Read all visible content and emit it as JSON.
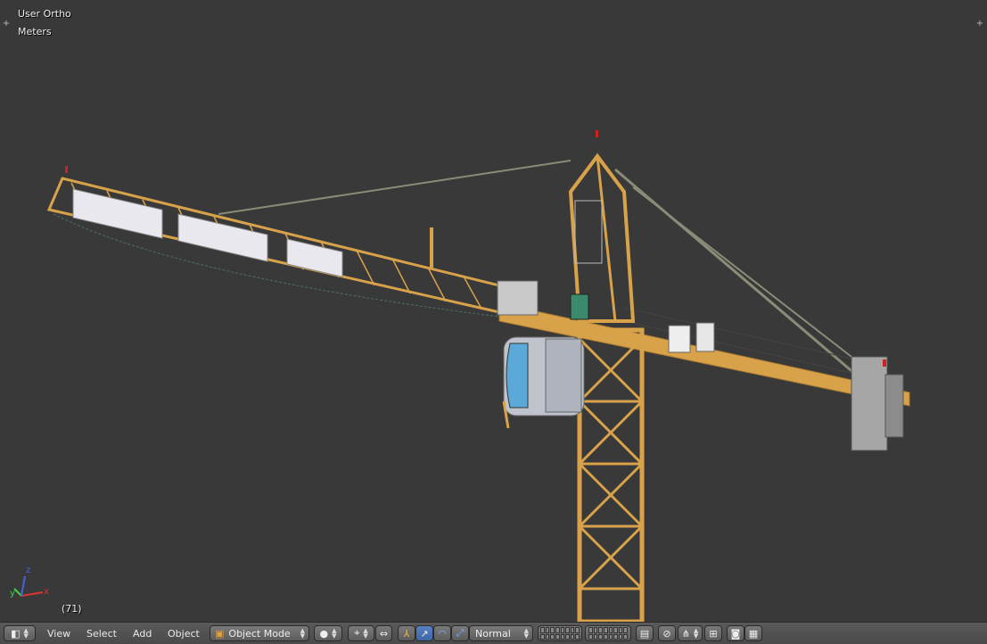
{
  "viewport": {
    "view_name": "User Ortho",
    "units": "Meters",
    "frame": "(71)"
  },
  "header": {
    "menus": [
      "View",
      "Select",
      "Add",
      "Object"
    ],
    "mode": "Object Mode",
    "pivot_label": "Normal"
  },
  "axes": {
    "x": "x",
    "y": "y",
    "z": "z"
  },
  "colors": {
    "background": "#393939",
    "crane": "#d8a24a",
    "cabin_glass": "#5aa9d8",
    "header": "#4f4f4f",
    "active_button": "#4a73b5"
  },
  "icons": [
    "viewport-type-icon",
    "viewport-shading-icon",
    "pivot-icon",
    "manipulator-icon",
    "layers-icon",
    "snap-icon",
    "render-icon"
  ]
}
